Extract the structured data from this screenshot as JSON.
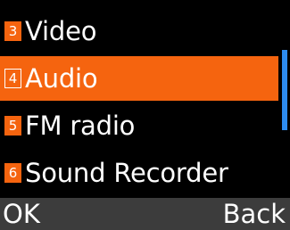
{
  "menu": {
    "items": [
      {
        "number": "3",
        "label": "Video",
        "selected": false
      },
      {
        "number": "4",
        "label": "Audio",
        "selected": true
      },
      {
        "number": "5",
        "label": "FM radio",
        "selected": false
      },
      {
        "number": "6",
        "label": "Sound Recorder",
        "selected": false
      }
    ]
  },
  "softkeys": {
    "left": "OK",
    "right": "Back"
  },
  "colors": {
    "accent": "#f5640f",
    "scrollbar": "#2d8cf0",
    "softkey_bar": "#3c3c3c",
    "background": "#000000"
  }
}
